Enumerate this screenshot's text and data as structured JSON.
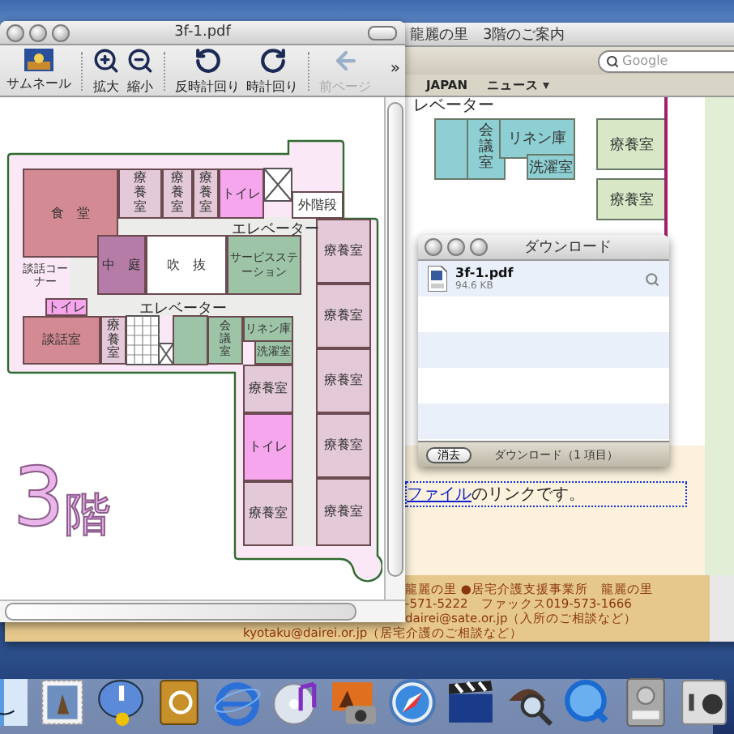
{
  "browser_window": {
    "title": "龍麗の里　3階のご案内",
    "search": {
      "placeholder": "Google"
    },
    "bookmarks": [
      {
        "label": "JAPAN",
        "menu": false
      },
      {
        "label": "ニュース",
        "menu": true
      }
    ],
    "page": {
      "plan_label": "レベーター",
      "rooms": [
        {
          "label": "会議室",
          "kind": "meeting",
          "vertical": true
        },
        {
          "label": "リネン庫",
          "kind": "linen",
          "vertical": false
        },
        {
          "label": "洗濯室",
          "kind": "laundry",
          "vertical": false
        },
        {
          "label": "療養室",
          "kind": "care",
          "vertical": false
        },
        {
          "label": "療養室",
          "kind": "care",
          "vertical": false
        }
      ],
      "link_sentence": {
        "link": "ファイル",
        "rest": "のリンクです。"
      },
      "footer_lines": [
        "龍麗の里 ●居宅介護支援事業所　龍麗の里",
        "-571-5222　ファックス019-573-1666",
        "dairei@sate.or.jp（入所のご相談など）",
        "kyotaku@dairei.or.jp（居宅介護のご相談など）"
      ]
    }
  },
  "preview_window": {
    "title": "3f-1.pdf",
    "toolbar": [
      {
        "label": "サムネール",
        "kind": "thumbnail",
        "disabled": false
      },
      {
        "label": "拡大",
        "kind": "zoom_in",
        "disabled": false
      },
      {
        "label": "縮小",
        "kind": "zoom_out",
        "disabled": false
      },
      {
        "label": "反時計回り",
        "kind": "rotate_ccw",
        "disabled": false
      },
      {
        "label": "時計回り",
        "kind": "rotate_cw",
        "disabled": false
      },
      {
        "label": "前ページ",
        "kind": "back",
        "disabled": true
      }
    ],
    "overflow": "»",
    "floor_plan": {
      "floor_number": "3",
      "floor_suffix": "階",
      "labels": [
        "エレベーター",
        "エレベーター"
      ],
      "rooms": [
        {
          "label": "食　堂",
          "kind": "dining",
          "vertical": false
        },
        {
          "label": "談話コーナー",
          "kind": "corner",
          "vertical": false
        },
        {
          "label": "療養室",
          "kind": "care",
          "vertical": true
        },
        {
          "label": "療養室",
          "kind": "care",
          "vertical": true
        },
        {
          "label": "療養室",
          "kind": "care",
          "vertical": true
        },
        {
          "label": "トイレ",
          "kind": "toilet",
          "vertical": false
        },
        {
          "label": "外階段",
          "kind": "stairs",
          "vertical": false
        },
        {
          "label": "中　庭",
          "kind": "courtyard",
          "vertical": false
        },
        {
          "label": "吹　抜",
          "kind": "void",
          "vertical": false
        },
        {
          "label": "サービスステーション",
          "kind": "staff",
          "vertical": false
        },
        {
          "label": "トイレ",
          "kind": "toilet",
          "vertical": false
        },
        {
          "label": "談話室",
          "kind": "dining",
          "vertical": false
        },
        {
          "label": "療養室",
          "kind": "care",
          "vertical": true
        },
        {
          "label": "会議室",
          "kind": "staff",
          "vertical": true
        },
        {
          "label": "リネン庫",
          "kind": "staff",
          "vertical": false
        },
        {
          "label": "洗濯室",
          "kind": "staff",
          "vertical": false
        },
        {
          "label": "療養室",
          "kind": "care",
          "vertical": false
        },
        {
          "label": "トイレ",
          "kind": "toilet",
          "vertical": false
        },
        {
          "label": "療養室",
          "kind": "care",
          "vertical": false
        },
        {
          "label": "療養室",
          "kind": "care",
          "vertical": false
        },
        {
          "label": "療養室",
          "kind": "care",
          "vertical": false
        },
        {
          "label": "療養室",
          "kind": "care",
          "vertical": false
        },
        {
          "label": "療養室",
          "kind": "care",
          "vertical": false
        },
        {
          "label": "療養室",
          "kind": "care",
          "vertical": false
        }
      ]
    }
  },
  "downloads_window": {
    "title": "ダウンロード",
    "items": [
      {
        "name": "3f-1.pdf",
        "size": "94.6 KB"
      }
    ],
    "clear_button": "消去",
    "status": "ダウンロード（1 項目）"
  }
}
